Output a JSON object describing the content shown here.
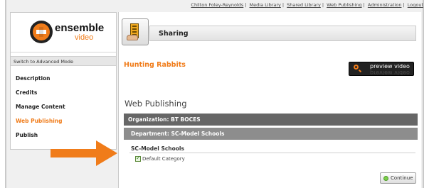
{
  "top_links": [
    "Chilton Foley-Reynolds",
    "Media Library",
    "Shared Library",
    "Web Publishing",
    "Administration",
    "Logout"
  ],
  "logo": {
    "word": "ensemble",
    "sub": "video"
  },
  "sidebar": {
    "switch_mode": "Switch to Advanced Mode",
    "items": [
      {
        "label": "Description"
      },
      {
        "label": "Credits"
      },
      {
        "label": "Manage Content"
      },
      {
        "label": "Web Publishing"
      },
      {
        "label": "Publish"
      }
    ]
  },
  "header": {
    "title": "Sharing"
  },
  "video": {
    "title": "Hunting Rabbits",
    "preview_label": "preview video"
  },
  "section": {
    "title": "Web Publishing",
    "organization": "Organization: BT BOCES",
    "department": "Department: SC-Model Schools",
    "school": "SC-Model Schools",
    "category": "Default Category"
  },
  "continue_label": "Continue",
  "colors": {
    "accent": "#f07c1a",
    "org_bar": "#666666",
    "dept_bar": "#8d8d8d"
  }
}
